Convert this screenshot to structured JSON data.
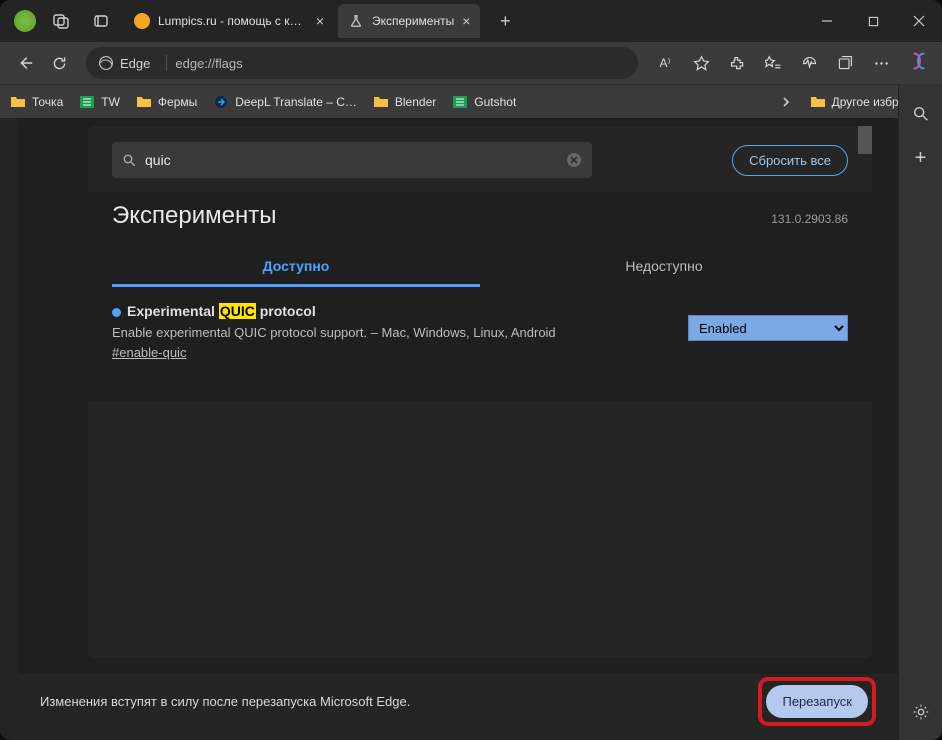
{
  "tabs": {
    "inactive": "Lumpics.ru - помощь с компьюте",
    "active": "Эксперименты"
  },
  "address": {
    "brand": "Edge",
    "url": "edge://flags"
  },
  "bookmarks": [
    "Точка",
    "TW",
    "Фермы",
    "DeepL Translate – C…",
    "Blender",
    "Gutshot"
  ],
  "bookmarks_other": "Другое избранное",
  "search": {
    "value": "quic",
    "reset": "Сбросить все"
  },
  "page": {
    "title": "Эксперименты",
    "version": "131.0.2903.86",
    "tab_available": "Доступно",
    "tab_unavailable": "Недоступно"
  },
  "flag": {
    "title_pre": "Experimental ",
    "title_hl": "QUIC",
    "title_post": " protocol",
    "desc": "Enable experimental QUIC protocol support. – Mac, Windows, Linux, Android",
    "anchor": "#enable-quic",
    "state": "Enabled"
  },
  "footer": {
    "msg": "Изменения вступят в силу после перезапуска Microsoft Edge.",
    "restart": "Перезапуск"
  }
}
